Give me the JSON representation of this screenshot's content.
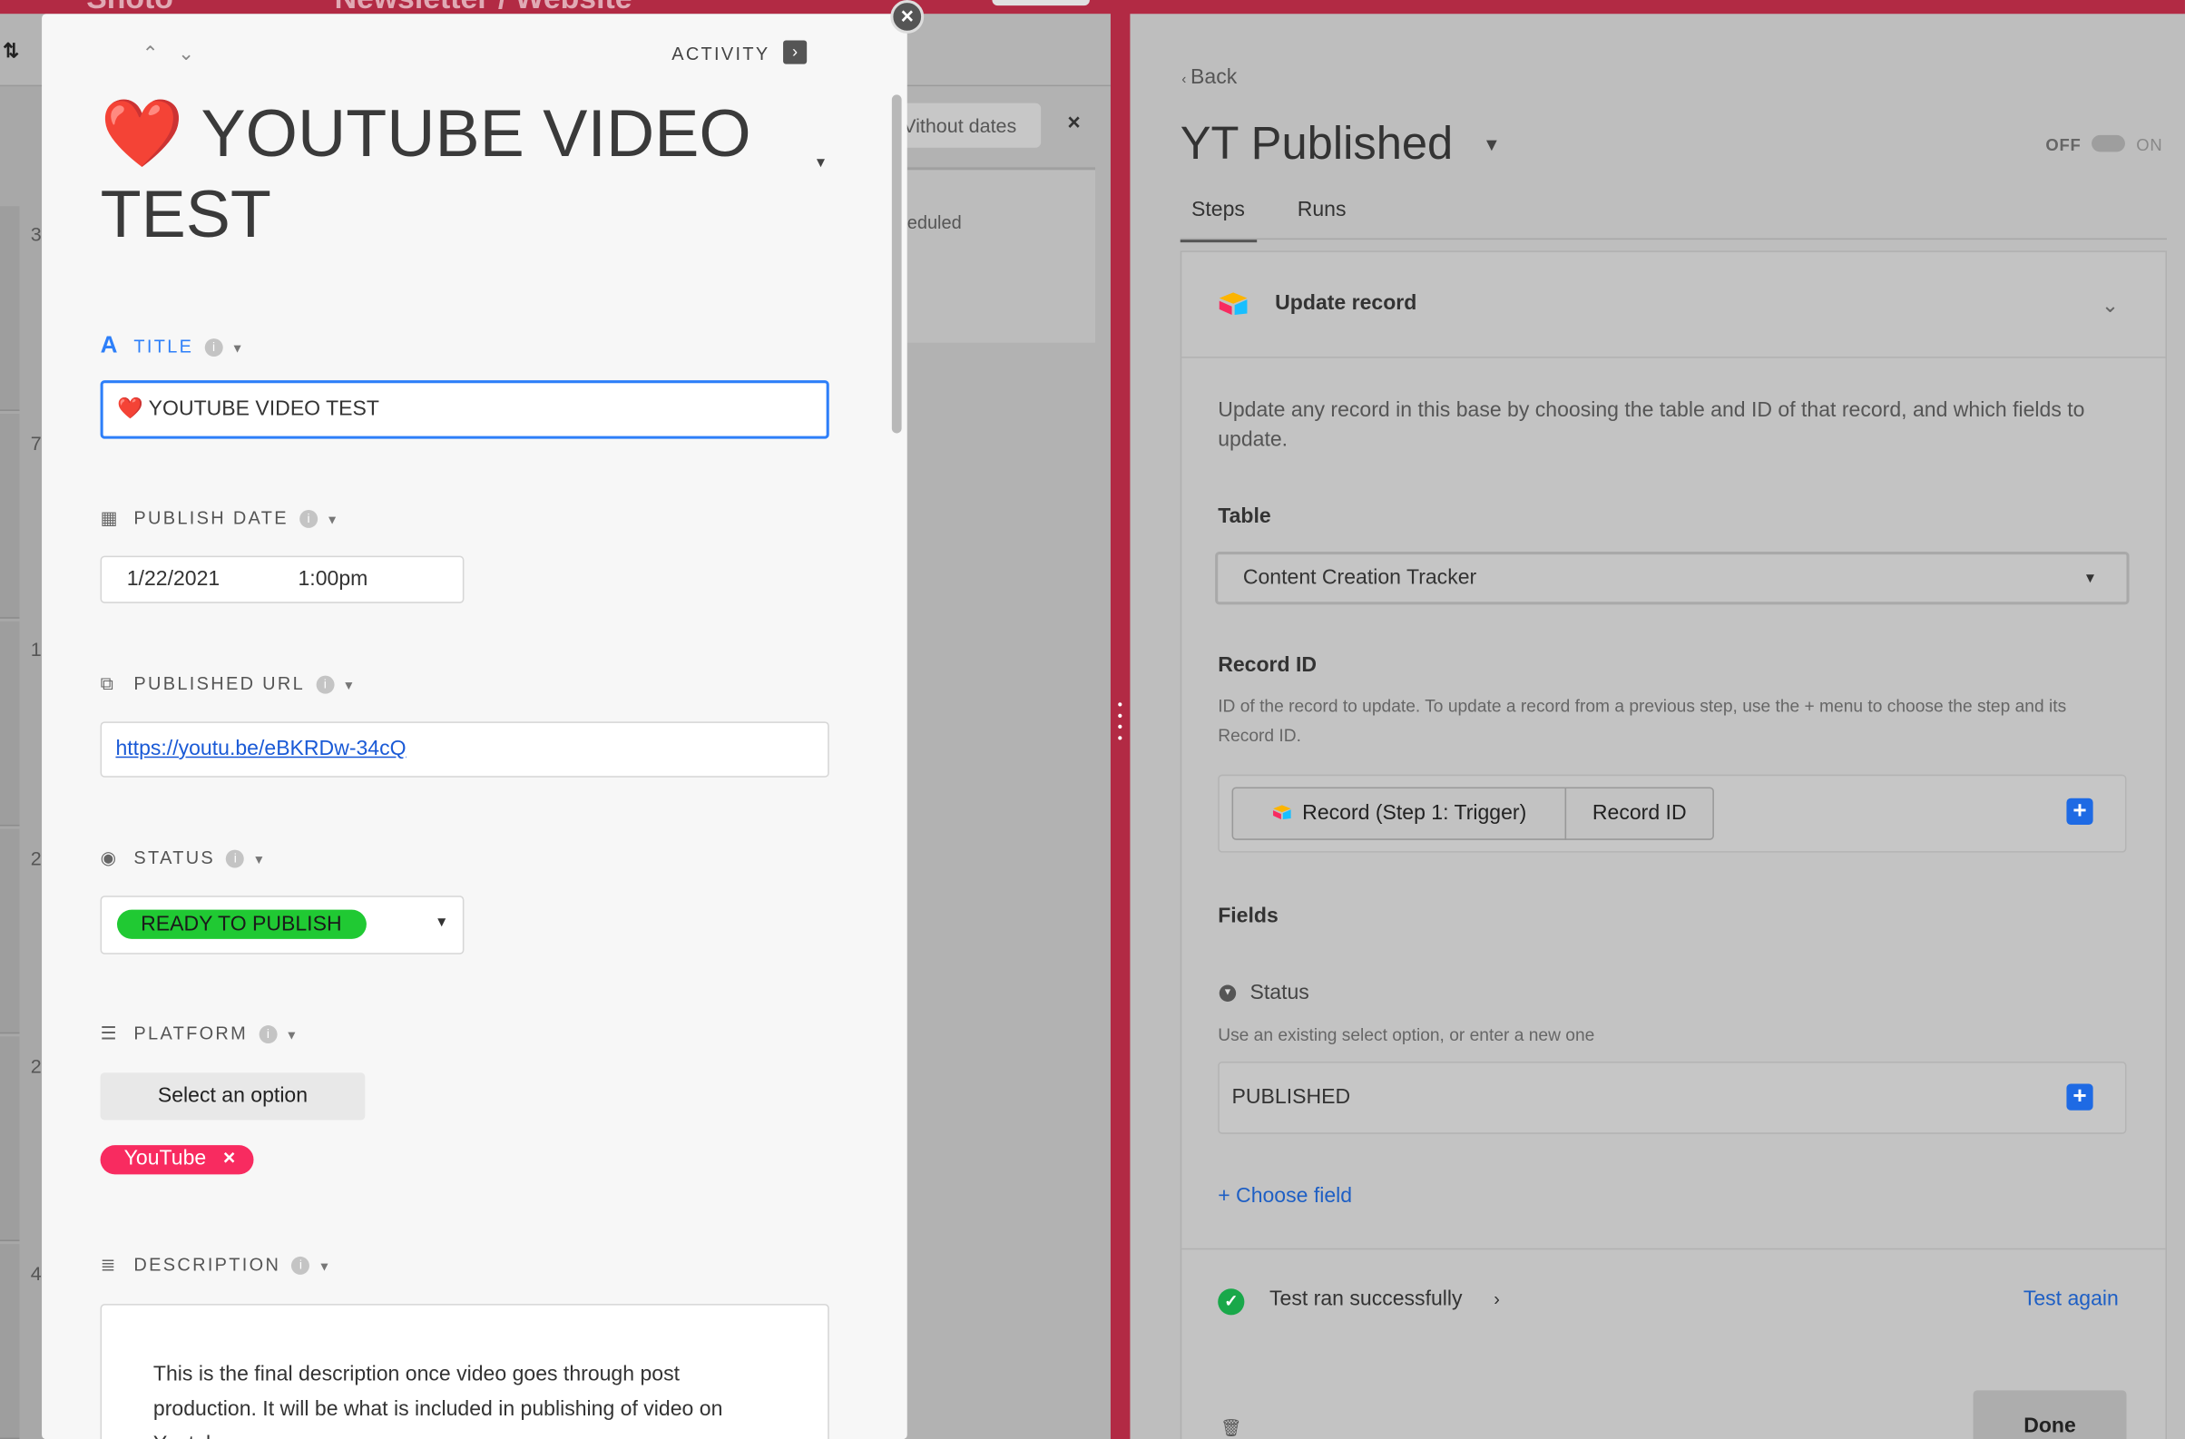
{
  "top_bar": {
    "left_text": "Shoto",
    "mid_text": "Newsletter / Website"
  },
  "background": {
    "sort_icon": "sort-icon",
    "row_numbers": [
      "3",
      "7",
      "1",
      "2",
      "2",
      "4"
    ],
    "without_dates": "Vithout dates",
    "close_glyph": "×",
    "scheduled_text": "eduled"
  },
  "modal": {
    "close_glyph": "×",
    "nav_arrows": "⌃⌄",
    "activity_label": "ACTIVITY",
    "activity_icon": "collapse-panel-icon",
    "heart": "❤️",
    "record_title": "YOUTUBE VIDEO TEST",
    "fields": {
      "title": {
        "label": "TITLE",
        "value": "❤️ YOUTUBE VIDEO TEST"
      },
      "publish_date": {
        "label": "PUBLISH DATE",
        "date": "1/22/2021",
        "time": "1:00pm"
      },
      "published_url": {
        "label": "PUBLISHED URL",
        "value": "https://youtu.be/eBKRDw-34cQ"
      },
      "status": {
        "label": "STATUS",
        "value": "READY TO PUBLISH",
        "color": "#20c933"
      },
      "platform": {
        "label": "PLATFORM",
        "select_label": "Select an option",
        "tag": "YouTube",
        "tag_color": "#f82b60",
        "tag_remove": "×"
      },
      "description": {
        "label": "DESCRIPTION",
        "value": "This is the final description once video goes through post production.  It will be what is included in publishing of video on Youtube"
      }
    }
  },
  "automation": {
    "back_label": "Back",
    "title": "YT Published",
    "toggle": {
      "off_label": "OFF",
      "on_label": "ON",
      "state": "off"
    },
    "tabs": [
      {
        "label": "Steps",
        "active": true
      },
      {
        "label": "Runs",
        "active": false
      }
    ],
    "step": {
      "title": "Update record",
      "description": "Update any record in this base by choosing the table and ID of that record, and which fields to update.",
      "table_label": "Table",
      "table_value": "Content Creation Tracker",
      "record_id_label": "Record ID",
      "record_id_hint": "ID of the record to update. To update a record from a previous step, use the + menu to choose the step and its Record ID.",
      "record_token_step": "Record (Step 1: Trigger)",
      "record_token_field": "Record ID",
      "fields_label": "Fields",
      "field_name": "Status",
      "field_hint": "Use an existing select option, or enter a new one",
      "field_value": "PUBLISHED",
      "choose_field": "+ Choose field",
      "test_status": "Test ran successfully",
      "test_again": "Test again",
      "done": "Done"
    }
  }
}
